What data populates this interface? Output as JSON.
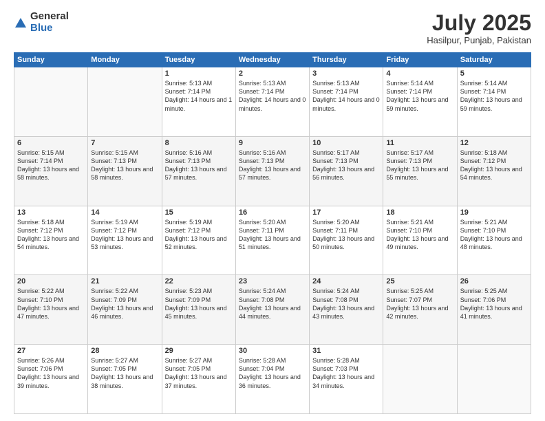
{
  "logo": {
    "general": "General",
    "blue": "Blue"
  },
  "header": {
    "month_year": "July 2025",
    "location": "Hasilpur, Punjab, Pakistan"
  },
  "weekdays": [
    "Sunday",
    "Monday",
    "Tuesday",
    "Wednesday",
    "Thursday",
    "Friday",
    "Saturday"
  ],
  "weeks": [
    [
      {
        "day": "",
        "sunrise": "",
        "sunset": "",
        "daylight": ""
      },
      {
        "day": "",
        "sunrise": "",
        "sunset": "",
        "daylight": ""
      },
      {
        "day": "1",
        "sunrise": "Sunrise: 5:13 AM",
        "sunset": "Sunset: 7:14 PM",
        "daylight": "Daylight: 14 hours and 1 minute."
      },
      {
        "day": "2",
        "sunrise": "Sunrise: 5:13 AM",
        "sunset": "Sunset: 7:14 PM",
        "daylight": "Daylight: 14 hours and 0 minutes."
      },
      {
        "day": "3",
        "sunrise": "Sunrise: 5:13 AM",
        "sunset": "Sunset: 7:14 PM",
        "daylight": "Daylight: 14 hours and 0 minutes."
      },
      {
        "day": "4",
        "sunrise": "Sunrise: 5:14 AM",
        "sunset": "Sunset: 7:14 PM",
        "daylight": "Daylight: 13 hours and 59 minutes."
      },
      {
        "day": "5",
        "sunrise": "Sunrise: 5:14 AM",
        "sunset": "Sunset: 7:14 PM",
        "daylight": "Daylight: 13 hours and 59 minutes."
      }
    ],
    [
      {
        "day": "6",
        "sunrise": "Sunrise: 5:15 AM",
        "sunset": "Sunset: 7:14 PM",
        "daylight": "Daylight: 13 hours and 58 minutes."
      },
      {
        "day": "7",
        "sunrise": "Sunrise: 5:15 AM",
        "sunset": "Sunset: 7:13 PM",
        "daylight": "Daylight: 13 hours and 58 minutes."
      },
      {
        "day": "8",
        "sunrise": "Sunrise: 5:16 AM",
        "sunset": "Sunset: 7:13 PM",
        "daylight": "Daylight: 13 hours and 57 minutes."
      },
      {
        "day": "9",
        "sunrise": "Sunrise: 5:16 AM",
        "sunset": "Sunset: 7:13 PM",
        "daylight": "Daylight: 13 hours and 57 minutes."
      },
      {
        "day": "10",
        "sunrise": "Sunrise: 5:17 AM",
        "sunset": "Sunset: 7:13 PM",
        "daylight": "Daylight: 13 hours and 56 minutes."
      },
      {
        "day": "11",
        "sunrise": "Sunrise: 5:17 AM",
        "sunset": "Sunset: 7:13 PM",
        "daylight": "Daylight: 13 hours and 55 minutes."
      },
      {
        "day": "12",
        "sunrise": "Sunrise: 5:18 AM",
        "sunset": "Sunset: 7:12 PM",
        "daylight": "Daylight: 13 hours and 54 minutes."
      }
    ],
    [
      {
        "day": "13",
        "sunrise": "Sunrise: 5:18 AM",
        "sunset": "Sunset: 7:12 PM",
        "daylight": "Daylight: 13 hours and 54 minutes."
      },
      {
        "day": "14",
        "sunrise": "Sunrise: 5:19 AM",
        "sunset": "Sunset: 7:12 PM",
        "daylight": "Daylight: 13 hours and 53 minutes."
      },
      {
        "day": "15",
        "sunrise": "Sunrise: 5:19 AM",
        "sunset": "Sunset: 7:12 PM",
        "daylight": "Daylight: 13 hours and 52 minutes."
      },
      {
        "day": "16",
        "sunrise": "Sunrise: 5:20 AM",
        "sunset": "Sunset: 7:11 PM",
        "daylight": "Daylight: 13 hours and 51 minutes."
      },
      {
        "day": "17",
        "sunrise": "Sunrise: 5:20 AM",
        "sunset": "Sunset: 7:11 PM",
        "daylight": "Daylight: 13 hours and 50 minutes."
      },
      {
        "day": "18",
        "sunrise": "Sunrise: 5:21 AM",
        "sunset": "Sunset: 7:10 PM",
        "daylight": "Daylight: 13 hours and 49 minutes."
      },
      {
        "day": "19",
        "sunrise": "Sunrise: 5:21 AM",
        "sunset": "Sunset: 7:10 PM",
        "daylight": "Daylight: 13 hours and 48 minutes."
      }
    ],
    [
      {
        "day": "20",
        "sunrise": "Sunrise: 5:22 AM",
        "sunset": "Sunset: 7:10 PM",
        "daylight": "Daylight: 13 hours and 47 minutes."
      },
      {
        "day": "21",
        "sunrise": "Sunrise: 5:22 AM",
        "sunset": "Sunset: 7:09 PM",
        "daylight": "Daylight: 13 hours and 46 minutes."
      },
      {
        "day": "22",
        "sunrise": "Sunrise: 5:23 AM",
        "sunset": "Sunset: 7:09 PM",
        "daylight": "Daylight: 13 hours and 45 minutes."
      },
      {
        "day": "23",
        "sunrise": "Sunrise: 5:24 AM",
        "sunset": "Sunset: 7:08 PM",
        "daylight": "Daylight: 13 hours and 44 minutes."
      },
      {
        "day": "24",
        "sunrise": "Sunrise: 5:24 AM",
        "sunset": "Sunset: 7:08 PM",
        "daylight": "Daylight: 13 hours and 43 minutes."
      },
      {
        "day": "25",
        "sunrise": "Sunrise: 5:25 AM",
        "sunset": "Sunset: 7:07 PM",
        "daylight": "Daylight: 13 hours and 42 minutes."
      },
      {
        "day": "26",
        "sunrise": "Sunrise: 5:25 AM",
        "sunset": "Sunset: 7:06 PM",
        "daylight": "Daylight: 13 hours and 41 minutes."
      }
    ],
    [
      {
        "day": "27",
        "sunrise": "Sunrise: 5:26 AM",
        "sunset": "Sunset: 7:06 PM",
        "daylight": "Daylight: 13 hours and 39 minutes."
      },
      {
        "day": "28",
        "sunrise": "Sunrise: 5:27 AM",
        "sunset": "Sunset: 7:05 PM",
        "daylight": "Daylight: 13 hours and 38 minutes."
      },
      {
        "day": "29",
        "sunrise": "Sunrise: 5:27 AM",
        "sunset": "Sunset: 7:05 PM",
        "daylight": "Daylight: 13 hours and 37 minutes."
      },
      {
        "day": "30",
        "sunrise": "Sunrise: 5:28 AM",
        "sunset": "Sunset: 7:04 PM",
        "daylight": "Daylight: 13 hours and 36 minutes."
      },
      {
        "day": "31",
        "sunrise": "Sunrise: 5:28 AM",
        "sunset": "Sunset: 7:03 PM",
        "daylight": "Daylight: 13 hours and 34 minutes."
      },
      {
        "day": "",
        "sunrise": "",
        "sunset": "",
        "daylight": ""
      },
      {
        "day": "",
        "sunrise": "",
        "sunset": "",
        "daylight": ""
      }
    ]
  ]
}
